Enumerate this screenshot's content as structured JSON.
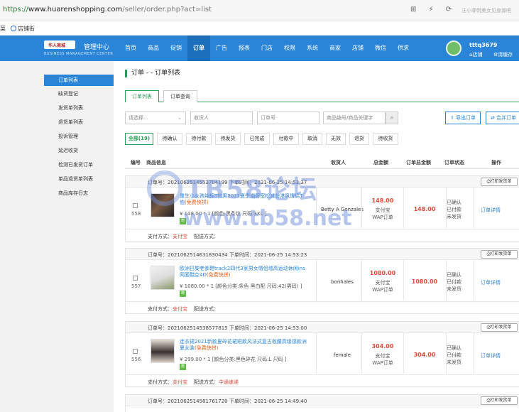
{
  "browser": {
    "url_protocol": "https://",
    "url_host": "www.huarenshopping.com",
    "url_path": "/seller/order.php?act=list",
    "search_hint": "汪小菲带美女见身源吧",
    "bookmarks": [
      "菜",
      "店铺街"
    ]
  },
  "header": {
    "logo_text": "华人商城",
    "brand": "管理中心",
    "brand_sub": "BUSINESS MANAGEMENT CENTER",
    "nav": [
      "首页",
      "商品",
      "促销",
      "订单",
      "广告",
      "报表",
      "门店",
      "权限",
      "系统",
      "商家",
      "店铺",
      "微信",
      "供求"
    ],
    "active_nav": "订单",
    "username": "tttq3679",
    "shop_link": "店铺",
    "clear_cache": "清缓存"
  },
  "sidebar": {
    "items": [
      "订单列表",
      "缺货登记",
      "发货单列表",
      "退货单列表",
      "投诉管理",
      "延迟收货",
      "检测已发货订单",
      "单品退货单列表",
      "商品库存日志"
    ],
    "active": "订单列表"
  },
  "page": {
    "title": "订单 - - 订单列表",
    "tabs": [
      "订单列表",
      "订单查询"
    ],
    "filters": {
      "select_placeholder": "请选择...",
      "receiver_placeholder": "收货人",
      "order_no_placeholder": "订单号",
      "goods_placeholder": "商品编号/商品关键字"
    },
    "export_btn": "导出订单",
    "merge_btn": "合并订单",
    "status_tabs": [
      "全部(19)",
      "待确认",
      "待付款",
      "待发货",
      "已完成",
      "付款中",
      "取消",
      "无效",
      "退货",
      "待收货"
    ],
    "columns": [
      "编号",
      "商品信息",
      "收货人",
      "总金额",
      "订单总金额",
      "订单状态",
      "操作"
    ]
  },
  "orders": [
    {
      "id": "558",
      "order_no_label": "订单号：2021062514553704199",
      "time_label": "下单时间：2021-06-25 14:53:37",
      "print": "打印发货单",
      "product": "重生小女孩纯棉T恤男2021夏季潮牌宽松减龄港风情侣T恤",
      "fast": "(免费快拼)",
      "spec": "¥ 148.00 * 1 [颜色:黑条纹 尺码:3XL ]",
      "gift": "赠",
      "receiver": "Betty A Gonzales",
      "amount": "148.00",
      "pay_lines": [
        "支付宝",
        "WAP订单"
      ],
      "total": "148.00",
      "status_lines": [
        "已确认",
        "已付款",
        "未发货"
      ],
      "detail": "订单详情",
      "pay_method_label": "支付方式：",
      "pay_method": "支付宝",
      "delivery_label": "配送方式：",
      "delivery": ""
    },
    {
      "id": "557",
      "order_no_label": "订单号：2021062514631830434",
      "time_label": "下单时间：2021-06-25 14:53:23",
      "print": "打印发货单",
      "product": "欧洲巴黎老爹鞋track2四代3家男女情侣增高运动休闲ins网面鞋空4D",
      "fast": "(免费快拼)",
      "spec": "¥ 1080.00 * 1 [颜色分类:条色 黑白配 尺码:42(男码) ]",
      "gift": "赠",
      "receiver": "bonhales",
      "amount": "1080.00",
      "pay_lines": [
        "支付宝",
        "WAP订单"
      ],
      "total": "1080.00",
      "status_lines": [
        "已确认",
        "已付款",
        "未发货"
      ],
      "detail": "订单详情",
      "pay_method_label": "支付方式：",
      "pay_method": "支付宝",
      "delivery_label": "配送方式：",
      "delivery": ""
    },
    {
      "id": "556",
      "order_no_label": "订单号：2021062514538577815",
      "time_label": "下单时间：2021-06-25 14:53:00",
      "print": "打印发货单",
      "product": "连衣裙2021新款夏碎花裙短款风法式复古收腰高级感款洲夏女装",
      "fast": "(免费快拼)",
      "spec": "¥ 299.00 * 1 [颜色分类:黑色碎花 尺码:L 尺码 ]",
      "gift": "赠",
      "receiver": "female",
      "amount": "304.00",
      "pay_lines": [
        "支付宝",
        "WAP订单"
      ],
      "total": "304.00",
      "status_lines": [
        "已确认",
        "已付款",
        "未发货"
      ],
      "detail": "订单详情",
      "pay_method_label": "支付方式：",
      "pay_method": "支付宝",
      "delivery_label": "配送方式：",
      "delivery": "中通速递"
    },
    {
      "order_no_label": "订单号：2021062514581761720",
      "time_label": "下单时间：2021-06-25 14:49:40",
      "print": "打印发货单"
    }
  ],
  "watermark": [
    "TB58论坛",
    "www.tb58.net"
  ]
}
